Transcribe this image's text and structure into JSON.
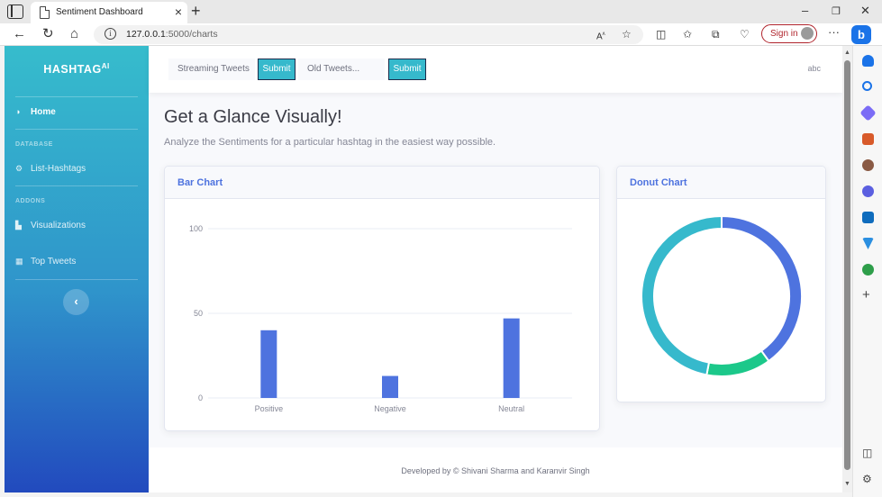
{
  "browser": {
    "tab_title": "Sentiment Dashboard",
    "url_host": "127.0.0.1",
    "url_path": ":5000/charts",
    "signin_label": "Sign in"
  },
  "sidebar": {
    "brand": "HASHTAG",
    "brand_sup": "AI",
    "items": [
      {
        "label": "Home",
        "icon": "tachometer-icon"
      },
      {
        "heading": "DATABASE"
      },
      {
        "label": "List-Hashtags",
        "icon": "cog-icon"
      },
      {
        "heading": "ADDONS"
      },
      {
        "label": "Visualizations",
        "icon": "chart-area-icon"
      },
      {
        "label": "Top Tweets",
        "icon": "table-icon"
      }
    ],
    "toggle_label": "‹"
  },
  "topbar": {
    "streaming_label": "Streaming Tweets",
    "submit_label": "Submit",
    "old_label": "Old Tweets...",
    "submit2_label": "Submit",
    "user": "abc"
  },
  "main": {
    "title": "Get a Glance Visually!",
    "subtitle": "Analyze the Sentiments for a particular hashtag in the easiest way possible.",
    "bar_card_title": "Bar Chart",
    "donut_card_title": "Donut Chart"
  },
  "footer": {
    "text": "Developed by © Shivani Sharma and Karanvir Singh"
  },
  "colors": {
    "primary": "#4e73df",
    "success": "#1cc88a",
    "info": "#36b9cc"
  },
  "chart_data": [
    {
      "type": "bar",
      "categories": [
        "Positive",
        "Negative",
        "Neutral"
      ],
      "values": [
        40,
        13,
        47
      ],
      "yticks": [
        0,
        50,
        100
      ],
      "ylim": [
        0,
        100
      ],
      "grid": true,
      "color": "#4e73df"
    },
    {
      "type": "pie",
      "donut": true,
      "slices": [
        {
          "value": 40,
          "color": "#4e73df"
        },
        {
          "value": 13,
          "color": "#1cc88a"
        },
        {
          "value": 47,
          "color": "#36b9cc"
        }
      ]
    }
  ]
}
